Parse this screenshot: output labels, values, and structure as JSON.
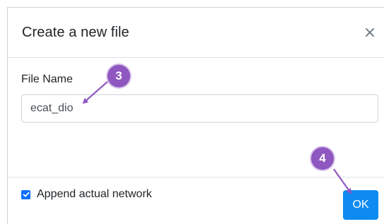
{
  "dialog": {
    "title": "Create a new file",
    "close_symbol": "×"
  },
  "form": {
    "file_name_label": "File Name",
    "file_name_value": "ecat_dio",
    "append_checked": true,
    "append_label": "Append actual network"
  },
  "footer": {
    "ok_label": "OK"
  },
  "annotations": {
    "step_a": "3",
    "step_b": "4"
  },
  "colors": {
    "primary": "#0d8bf0",
    "checkbox": "#0d6efd",
    "annotation": "#8f57c0"
  },
  "icons": {
    "close": "close-icon",
    "check": "check-icon",
    "arrow": "arrow-icon"
  }
}
